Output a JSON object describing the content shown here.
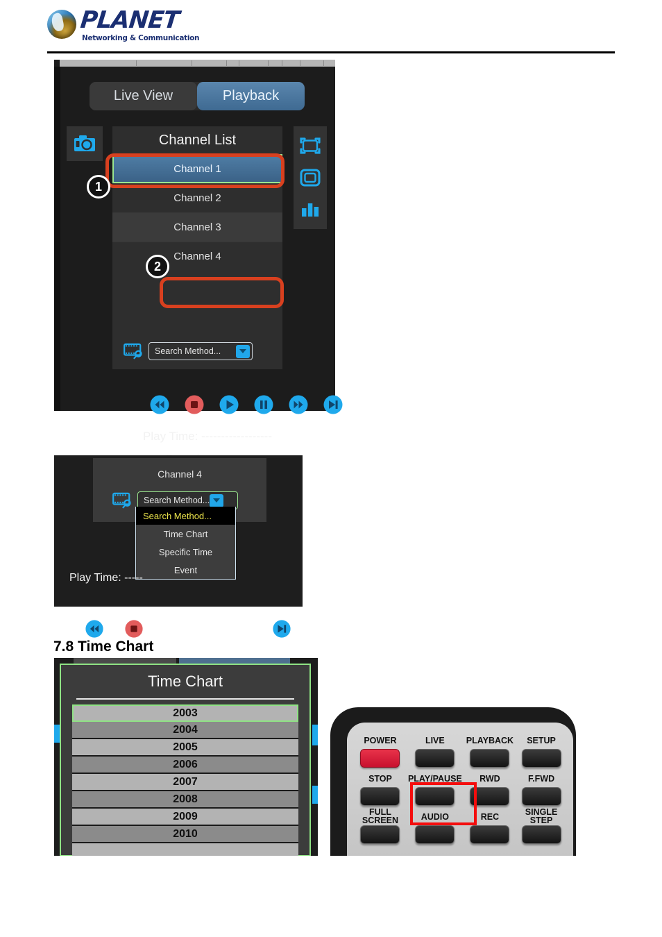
{
  "brand": {
    "name": "PLANET",
    "tagline": "Networking & Communication",
    "logo_icon": "planet-globe-icon"
  },
  "section": {
    "number_title": "7.8 Time Chart"
  },
  "figure_playback": {
    "tabs": [
      {
        "label": "Live View",
        "active": false
      },
      {
        "label": "Playback",
        "active": true
      }
    ],
    "channel_panel": {
      "title": "Channel List",
      "channels": [
        {
          "label": "Channel 1",
          "selected": true
        },
        {
          "label": "Channel 2",
          "selected": false
        },
        {
          "label": "Channel 3",
          "selected": false
        },
        {
          "label": "Channel 4",
          "selected": false
        }
      ],
      "search_combo": {
        "value": "Search Method...",
        "icon": "film-search-icon",
        "arrow_icon": "chevron-down-icon"
      }
    },
    "left_tools": [
      {
        "icon": "snapshot-camera-icon"
      }
    ],
    "right_tools": [
      {
        "icon": "full-screen-icon"
      },
      {
        "icon": "single-screen-icon"
      },
      {
        "icon": "bar-chart-icon"
      }
    ],
    "transport": [
      {
        "icon": "rewind-icon",
        "color": "#1fa9ec"
      },
      {
        "icon": "stop-icon",
        "color": "#e25c5c"
      },
      {
        "icon": "play-icon",
        "color": "#1fa9ec"
      },
      {
        "icon": "pause-icon",
        "color": "#1fa9ec"
      },
      {
        "icon": "fast-forward-icon",
        "color": "#1fa9ec"
      },
      {
        "icon": "next-frame-icon",
        "color": "#1fa9ec"
      }
    ],
    "status": {
      "play_time_label": "Play Time:",
      "play_time_value": "------------------",
      "speed_label": "Speed:",
      "speed_value": "--"
    },
    "callouts": [
      {
        "number": "1"
      },
      {
        "number": "2"
      }
    ],
    "highlight_color": "#d8401f"
  },
  "figure_dropdown": {
    "channel_label": "Channel 4",
    "combo": {
      "value": "Search Method...",
      "icon": "film-search-icon",
      "arrow_icon": "chevron-down-icon"
    },
    "options": [
      {
        "label": "Search Method...",
        "highlighted": true
      },
      {
        "label": "Time Chart",
        "highlighted": false
      },
      {
        "label": "Specific Time",
        "highlighted": false
      },
      {
        "label": "Event",
        "highlighted": false
      }
    ],
    "transport": [
      {
        "icon": "rewind-icon",
        "color": "#1fa9ec"
      },
      {
        "icon": "stop-icon",
        "color": "#e25c5c"
      },
      {
        "icon": "next-frame-icon",
        "color": "#1fa9ec"
      }
    ],
    "play_time_label": "Play Time: -----"
  },
  "figure_time_chart": {
    "title": "Time Chart",
    "rows": [
      {
        "label": "2003",
        "selected": true
      },
      {
        "label": "2004",
        "selected": false
      },
      {
        "label": "2005",
        "selected": false
      },
      {
        "label": "2006",
        "selected": false
      },
      {
        "label": "2007",
        "selected": false
      },
      {
        "label": "2008",
        "selected": false
      },
      {
        "label": "2009",
        "selected": false
      },
      {
        "label": "2010",
        "selected": false
      }
    ],
    "selection_color": "#8fe384"
  },
  "figure_remote": {
    "keys": [
      {
        "label": "POWER",
        "color": "#c8102e",
        "highlighted": false
      },
      {
        "label": "LIVE",
        "color": "#141414",
        "highlighted": false
      },
      {
        "label": "PLAYBACK",
        "color": "#141414",
        "highlighted": false
      },
      {
        "label": "SETUP",
        "color": "#141414",
        "highlighted": false
      },
      {
        "label": "STOP",
        "color": "#141414",
        "highlighted": false
      },
      {
        "label": "PLAY/PAUSE",
        "color": "#141414",
        "highlighted": true
      },
      {
        "label": "RWD",
        "color": "#141414",
        "highlighted": false
      },
      {
        "label": "F.FWD",
        "color": "#141414",
        "highlighted": false
      },
      {
        "label": "FULL SCREEN",
        "color": "#141414",
        "highlighted": false
      },
      {
        "label": "AUDIO",
        "color": "#141414",
        "highlighted": false
      },
      {
        "label": "REC",
        "color": "#141414",
        "highlighted": false
      },
      {
        "label": "SINGLE STEP",
        "color": "#141414",
        "highlighted": false
      }
    ],
    "highlight_color": "#f40d0d"
  }
}
